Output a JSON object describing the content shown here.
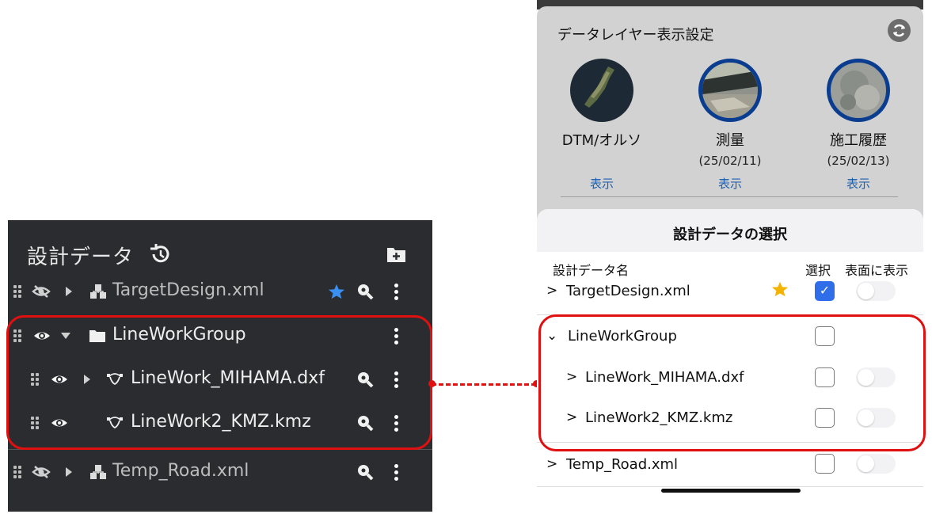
{
  "left_panel": {
    "title": "設計データ",
    "rows": [
      {
        "name": "TargetDesign.xml",
        "visible": false,
        "type": "design",
        "starred": true
      },
      {
        "name": "LineWorkGroup",
        "visible": true,
        "type": "folder",
        "expanded": true
      },
      {
        "name": "LineWork_MIHAMA.dxf",
        "visible": true,
        "type": "linework"
      },
      {
        "name": "LineWork2_KMZ.kmz",
        "visible": true,
        "type": "linework"
      },
      {
        "name": "Temp_Road.xml",
        "visible": false,
        "type": "design"
      }
    ]
  },
  "layer_sheet": {
    "title": "データレイヤー表示設定",
    "layers": [
      {
        "name": "DTM/オルソ",
        "date": "",
        "action": "表示"
      },
      {
        "name": "測量",
        "date": "(25/02/11)",
        "action": "表示"
      },
      {
        "name": "施工履歴",
        "date": "(25/02/13)",
        "action": "表示"
      }
    ]
  },
  "design_sheet": {
    "title": "設計データの選択",
    "col_name": "設計データ名",
    "col_select": "選択",
    "col_surface": "表面に表示",
    "rows": [
      {
        "name": "TargetDesign.xml",
        "selected": true,
        "starred": true
      },
      {
        "name": "LineWorkGroup",
        "selected": false
      },
      {
        "name": "LineWork_MIHAMA.dxf",
        "selected": false
      },
      {
        "name": "LineWork2_KMZ.kmz",
        "selected": false
      },
      {
        "name": "Temp_Road.xml",
        "selected": false
      }
    ]
  },
  "colors": {
    "highlight": "#e01010",
    "accent_blue": "#2f6ee8",
    "star_left": "#3a8ff0",
    "star_right": "#f5b301"
  }
}
